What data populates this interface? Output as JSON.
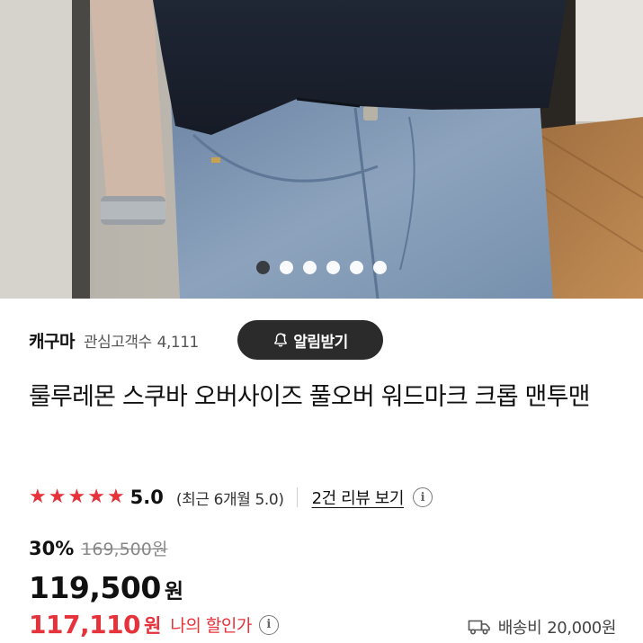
{
  "carousel": {
    "total": 6,
    "active_index": 0
  },
  "seller": {
    "name": "캐구마",
    "followers_label": "관심고객수",
    "followers_count": "4,111",
    "notify_label": "알림받기"
  },
  "product": {
    "title": "룰루레몬 스쿠바 오버사이즈 풀오버 워드마크 크롭 맨투맨"
  },
  "rating": {
    "stars": 5,
    "score": "5.0",
    "recent": "(최근 6개월 5.0)",
    "reviews_link": "2건 리뷰 보기",
    "info": "i"
  },
  "price": {
    "discount": "30%",
    "original": "169,500원",
    "sale": "119,500",
    "sale_unit": "원",
    "my_price": "117,110",
    "my_unit": "원",
    "my_label": "나의 할인가",
    "my_info": "i"
  },
  "shipping": {
    "label": "배송비",
    "value": "20,000원",
    "icon": "truck-icon"
  },
  "colors": {
    "accent_red": "#e5323b",
    "notify_bg": "#2b2b2b"
  }
}
